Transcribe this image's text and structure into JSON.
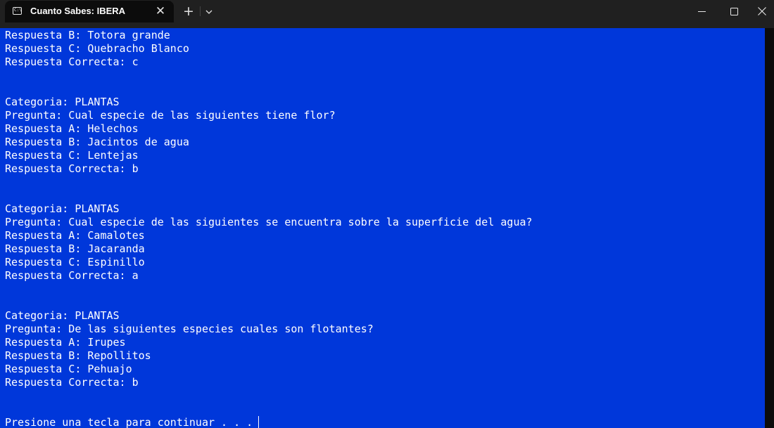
{
  "window": {
    "tab_title": "Cuanto Sabes: IBERA",
    "tab_icon": "terminal-icon",
    "close_tab_glyph": "✕",
    "new_tab_glyph": "+",
    "minimize_icon": "minimize-icon",
    "maximize_icon": "maximize-icon",
    "close_icon": "close-icon"
  },
  "colors": {
    "terminal_background": "#0037da",
    "text": "#ffffff",
    "titlebar": "#202020"
  },
  "terminal": {
    "lines": [
      "Respuesta B: Totora grande",
      "Respuesta C: Quebracho Blanco",
      "Respuesta Correcta: c",
      "",
      "",
      "Categoria: PLANTAS",
      "Pregunta: Cual especie de las siguientes tiene flor?",
      "Respuesta A: Helechos",
      "Respuesta B: Jacintos de agua",
      "Respuesta C: Lentejas",
      "Respuesta Correcta: b",
      "",
      "",
      "Categoria: PLANTAS",
      "Pregunta: Cual especie de las siguientes se encuentra sobre la superficie del agua?",
      "Respuesta A: Camalotes",
      "Respuesta B: Jacaranda",
      "Respuesta C: Espinillo",
      "Respuesta Correcta: a",
      "",
      "",
      "Categoria: PLANTAS",
      "Pregunta: De las siguientes especies cuales son flotantes?",
      "Respuesta A: Irupes",
      "Respuesta B: Repollitos",
      "Respuesta C: Pehuajo",
      "Respuesta Correcta: b",
      "",
      "",
      "Presione una tecla para continuar . . ."
    ]
  }
}
